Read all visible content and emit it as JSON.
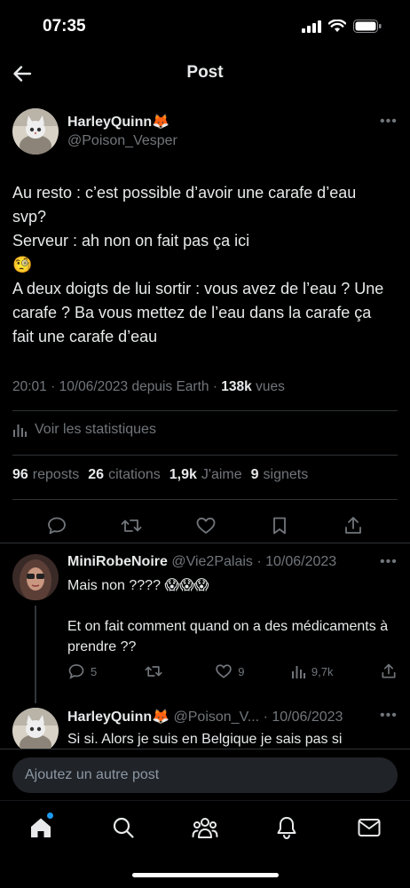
{
  "status_bar": {
    "time": "07:35"
  },
  "header": {
    "title": "Post"
  },
  "post": {
    "display_name": "HarleyQuinn🦊",
    "handle": "@Poison_Vesper",
    "text": "Au resto : c’est possible d’avoir une carafe d’eau svp?\nServeur : ah non on fait pas ça ici\n🧐\nA deux doigts de lui sortir : vous avez de l’eau ? Une carafe ? Ba vous mettez de l’eau dans la carafe ça fait une carafe d’eau",
    "time": "20:01",
    "date": "10/06/2023",
    "source": "depuis Earth",
    "views_count": "138k",
    "views_label": "vues",
    "stats_link": "Voir les statistiques",
    "reposts_count": "96",
    "reposts_label": "reposts",
    "quotes_count": "26",
    "quotes_label": "citations",
    "likes_count": "1,9k",
    "likes_label": "J'aime",
    "bookmarks_count": "9",
    "bookmarks_label": "signets"
  },
  "replies": [
    {
      "display_name": "MiniRobeNoire",
      "handle": "@Vie2Palais",
      "date": "10/06/2023",
      "text": "Mais non ???? 😱😱😱\n\nEt on fait comment quand on a des médicaments à prendre ??",
      "reply_count": "5",
      "repost_count": "",
      "like_count": "9",
      "views_count": "9,7k"
    },
    {
      "display_name": "HarleyQuinn🦊",
      "handle": "@Poison_V...",
      "date": "10/06/2023",
      "text": "Si si. Alors je suis en Belgique je sais pas si"
    }
  ],
  "composer": {
    "placeholder": "Ajoutez un autre post"
  },
  "colors": {
    "background": "#000000",
    "accent": "#1d9bf0",
    "muted": "#71767b",
    "text": "#e7e9ea"
  },
  "icons": [
    "back-arrow-icon",
    "more-icon",
    "stats-icon",
    "reply-icon",
    "repost-icon",
    "like-icon",
    "bookmark-icon",
    "share-icon",
    "home-icon",
    "search-icon",
    "communities-icon",
    "notifications-icon",
    "messages-icon"
  ]
}
